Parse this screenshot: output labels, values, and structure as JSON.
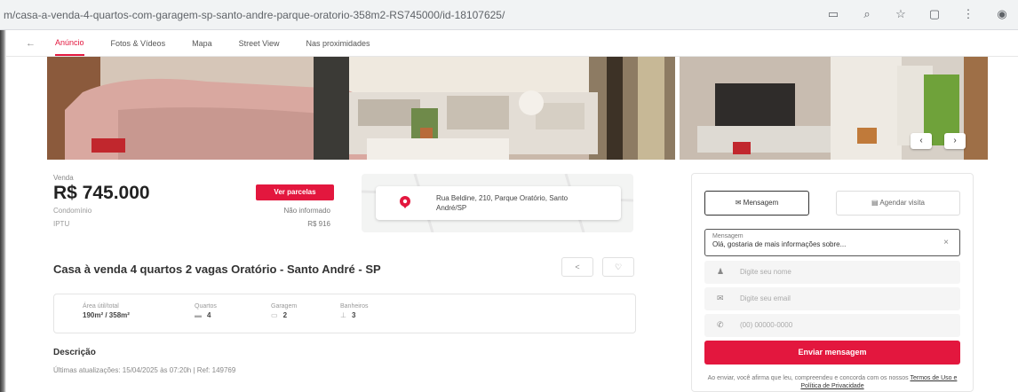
{
  "browser": {
    "url": "m/casa-a-venda-4-quartos-com-garagem-sp-santo-andre-parque-oratorio-358m2-RS745000/id-18107625/",
    "icons": [
      "cast-icon",
      "zoom-icon",
      "star-icon",
      "extensions-icon",
      "menu-icon",
      "profile-icon"
    ]
  },
  "tabs": [
    "Anúncio",
    "Fotos & Vídeos",
    "Mapa",
    "Street View",
    "Nas proximidades"
  ],
  "listing": {
    "type_label": "Venda",
    "price": "R$ 745.000",
    "condo_label": "Condomínio",
    "iptu_label": "IPTU",
    "see_button": "Ver parcelas",
    "condo_value": "Não informado",
    "iptu_value": "R$ 916",
    "address": "Rua Beldine, 210, Parque Oratório, Santo André/SP",
    "title": "Casa à venda 4 quartos 2 vagas Oratório - Santo André - SP",
    "share_label": "<",
    "favorite_label": "♡"
  },
  "features": [
    {
      "label": "Área útil/total",
      "value": "190m² / 358m²",
      "icon": ""
    },
    {
      "label": "Quartos",
      "value": "4",
      "icon": "bed-icon"
    },
    {
      "label": "Garagem",
      "value": "2",
      "icon": "car-icon"
    },
    {
      "label": "Banheiros",
      "value": "3",
      "icon": "bath-icon"
    }
  ],
  "description": {
    "heading": "Descrição",
    "update": "Últimas atualizações: 15/04/2025 às 07:20h | Ref: 149769"
  },
  "contact": {
    "message_button": "Mensagem",
    "visit_button": "Agendar visita",
    "message_label": "Mensagem",
    "message_value": "Olá, gostaria de mais informações sobre...",
    "name_placeholder": "Digite seu nome",
    "email_placeholder": "Digite seu email",
    "phone_placeholder": "(00) 00000-0000",
    "send_button": "Enviar mensagem",
    "terms_text": "Ao enviar, você afirma que leu, compreendeu e concorda com os nossos",
    "terms_link": "Termos de Uso e Política de Privacidade"
  },
  "colors": {
    "accent": "#e3173e",
    "text": "#333333"
  }
}
